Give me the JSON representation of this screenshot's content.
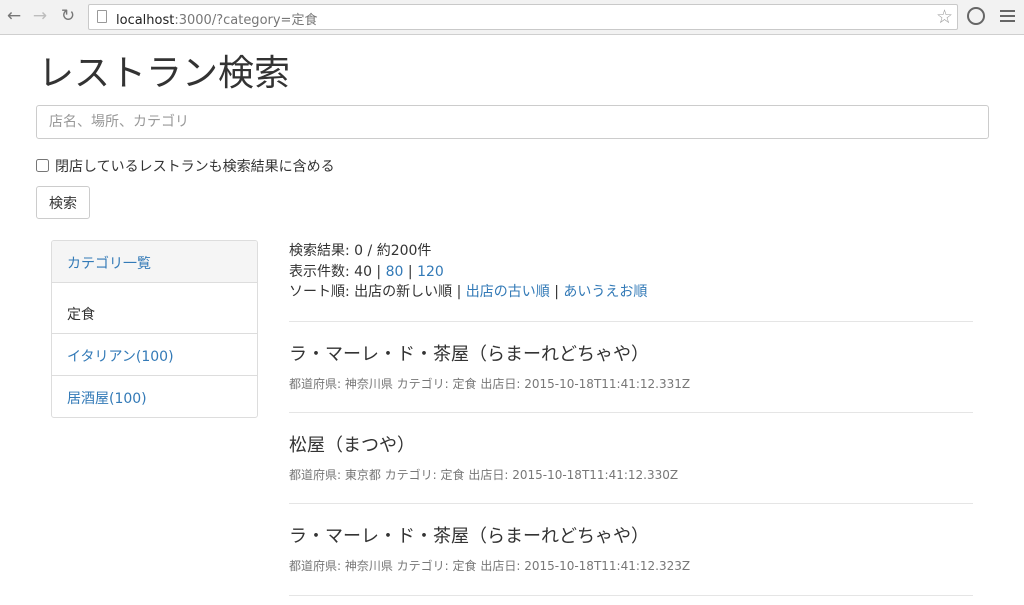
{
  "browser": {
    "url_host": "localhost",
    "url_rest": ":3000/?category=定食"
  },
  "page": {
    "title": "レストラン検索",
    "search_placeholder": "店名、場所、カテゴリ",
    "include_closed_label": "閉店しているレストランも検索結果に含める",
    "include_closed_checked": false,
    "search_button": "検索"
  },
  "sidebar": {
    "heading": "カテゴリ一覧",
    "items": [
      {
        "label": "定食",
        "active": true
      },
      {
        "label": "イタリアン(100)",
        "active": false
      },
      {
        "label": "居酒屋(100)",
        "active": false
      }
    ]
  },
  "results_meta": {
    "count_label": "検索結果: 0 / 約200件",
    "per_page_prefix": "表示件数: 40 | ",
    "per_page_80": "80",
    "sep": " | ",
    "per_page_120": "120",
    "sort_prefix": "ソート順: 出店の新しい順 | ",
    "sort_old": "出店の古い順",
    "sort_sep": " | ",
    "sort_kana": "あいうえお順"
  },
  "results": [
    {
      "title": "ラ・マーレ・ド・茶屋（らまーれどちゃや）",
      "info": "都道府県: 神奈川県 カテゴリ: 定食 出店日: 2015-10-18T11:41:12.331Z"
    },
    {
      "title": "松屋（まつや）",
      "info": "都道府県: 東京都 カテゴリ: 定食 出店日: 2015-10-18T11:41:12.330Z"
    },
    {
      "title": "ラ・マーレ・ド・茶屋（らまーれどちゃや）",
      "info": "都道府県: 神奈川県 カテゴリ: 定食 出店日: 2015-10-18T11:41:12.323Z"
    }
  ]
}
